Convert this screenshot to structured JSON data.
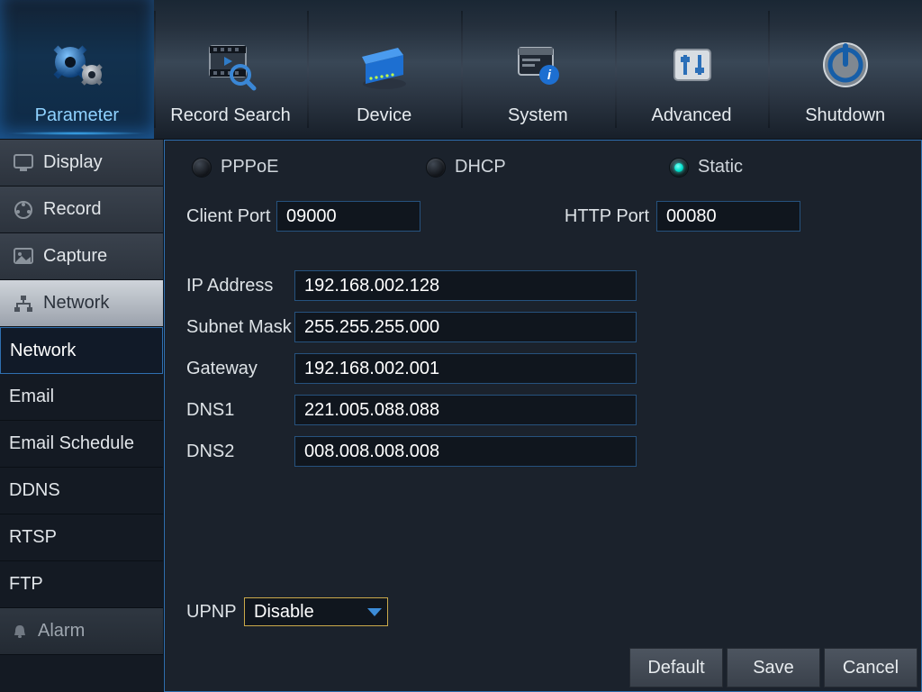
{
  "topnav": [
    {
      "id": "parameter",
      "label": "Parameter"
    },
    {
      "id": "record-search",
      "label": "Record Search"
    },
    {
      "id": "device",
      "label": "Device"
    },
    {
      "id": "system",
      "label": "System"
    },
    {
      "id": "advanced",
      "label": "Advanced"
    },
    {
      "id": "shutdown",
      "label": "Shutdown"
    }
  ],
  "sidebar_categories": [
    {
      "id": "display",
      "label": "Display"
    },
    {
      "id": "record",
      "label": "Record"
    },
    {
      "id": "capture",
      "label": "Capture"
    },
    {
      "id": "network",
      "label": "Network"
    }
  ],
  "sidebar_sub": [
    {
      "id": "network",
      "label": "Network"
    },
    {
      "id": "email",
      "label": "Email"
    },
    {
      "id": "email-schedule",
      "label": "Email Schedule"
    },
    {
      "id": "ddns",
      "label": "DDNS"
    },
    {
      "id": "rtsp",
      "label": "RTSP"
    },
    {
      "id": "ftp",
      "label": "FTP"
    },
    {
      "id": "alarm",
      "label": "Alarm"
    }
  ],
  "radios": {
    "pppoe": "PPPoE",
    "dhcp": "DHCP",
    "static": "Static"
  },
  "labels": {
    "client_port": "Client Port",
    "http_port": "HTTP Port",
    "ip_address": "IP Address",
    "subnet_mask": "Subnet Mask",
    "gateway": "Gateway",
    "dns1": "DNS1",
    "dns2": "DNS2",
    "upnp": "UPNP"
  },
  "values": {
    "client_port": "09000",
    "http_port": "00080",
    "ip_address": "192.168.002.128",
    "subnet_mask": "255.255.255.000",
    "gateway": "192.168.002.001",
    "dns1": "221.005.088.088",
    "dns2": "008.008.008.008",
    "upnp": "Disable"
  },
  "buttons": {
    "default": "Default",
    "save": "Save",
    "cancel": "Cancel"
  }
}
